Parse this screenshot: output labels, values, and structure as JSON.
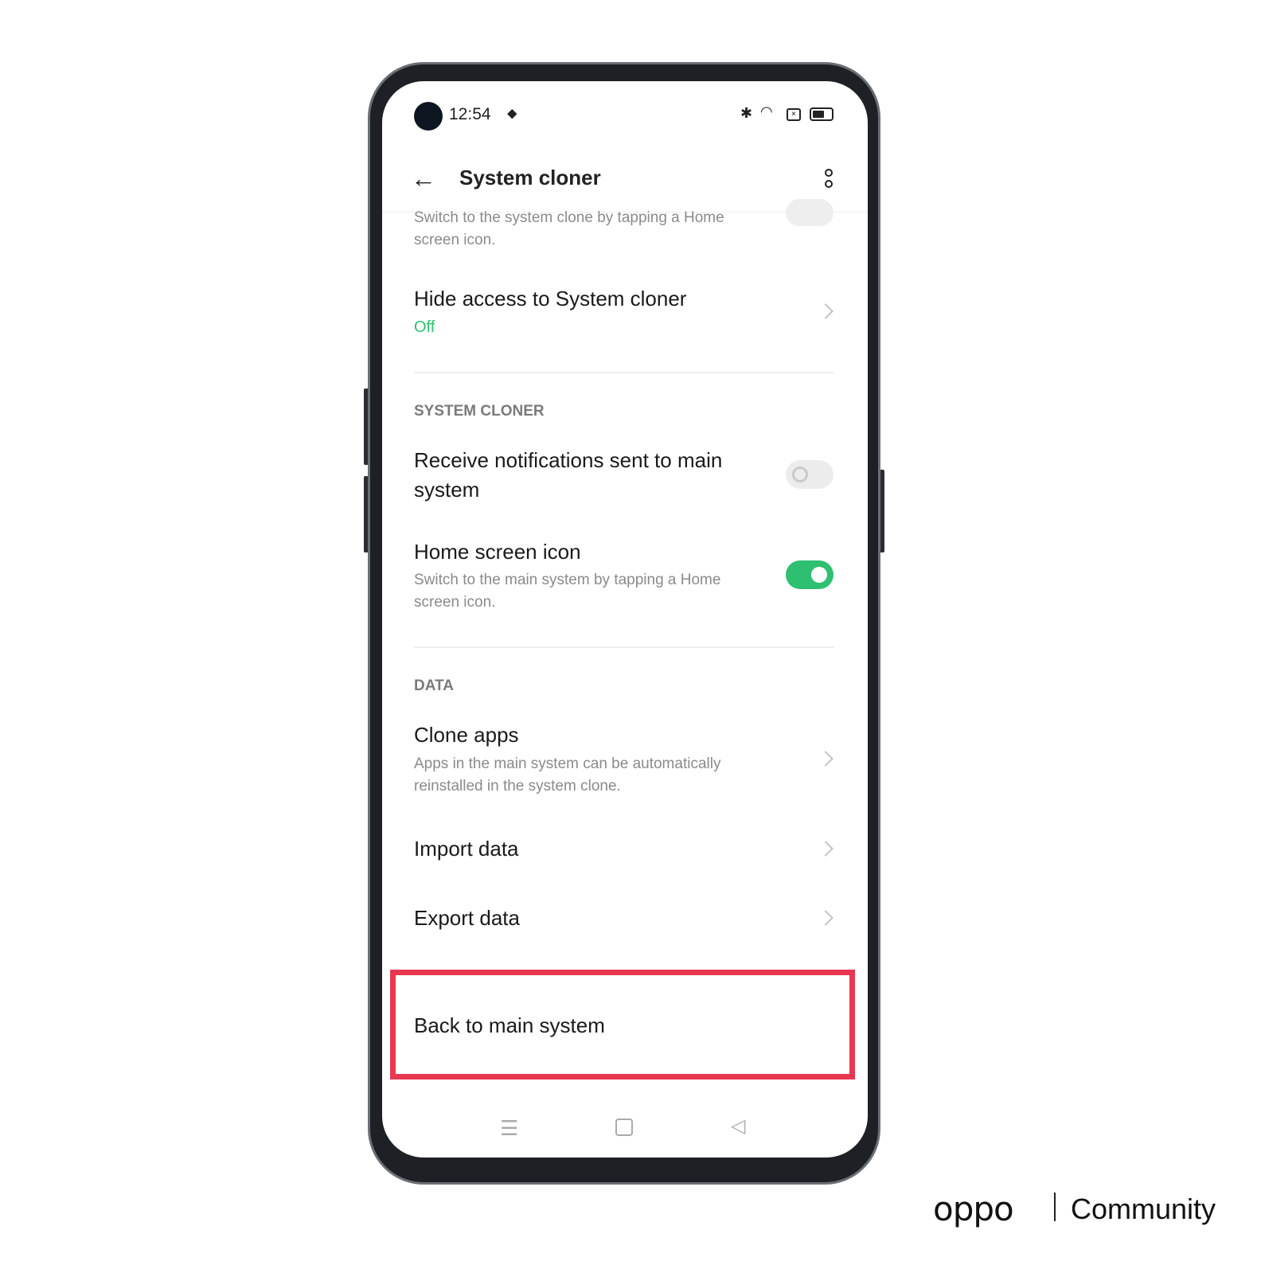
{
  "status_bar": {
    "time": "12:54"
  },
  "header": {
    "title": "System cloner"
  },
  "items": {
    "top_sub": "Switch to the system clone by tapping a Home screen icon.",
    "hide_access": {
      "label": "Hide access to System cloner",
      "value": "Off"
    },
    "section_cloner": "SYSTEM CLONER",
    "receive_notif": {
      "label": "Receive notifications sent to main system",
      "enabled": false
    },
    "home_icon": {
      "label": "Home screen icon",
      "sub": "Switch to the main system by tapping a Home screen icon.",
      "enabled": true
    },
    "section_data": "DATA",
    "clone_apps": {
      "label": "Clone apps",
      "sub": "Apps in the main system can be automatically reinstalled in the system clone."
    },
    "import": "Import data",
    "export": "Export data",
    "back_main": "Back to main system"
  },
  "colors": {
    "accent": "#2fbf71",
    "highlight": "#e8384f"
  },
  "watermark": {
    "logo": "oppo",
    "text": "Community"
  }
}
